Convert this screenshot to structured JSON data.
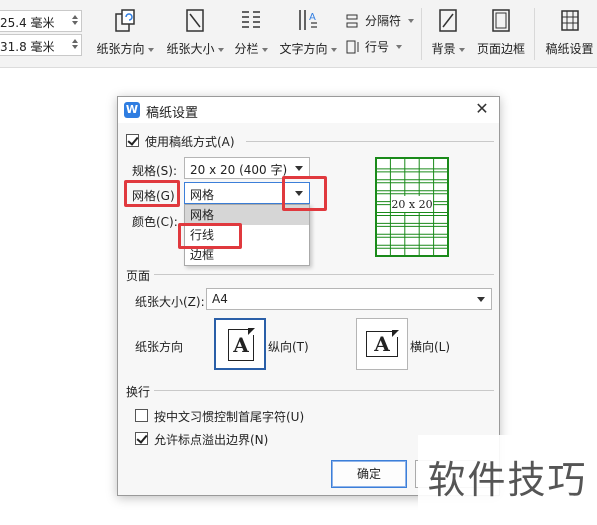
{
  "ribbon": {
    "margin_top_value": "25.4 毫米",
    "margin_bottom_value": "31.8 毫米",
    "paper_orientation": "纸张方向",
    "paper_size": "纸张大小",
    "columns": "分栏",
    "text_direction": "文字方向",
    "separator": "分隔符",
    "line_number": "行号",
    "background": "背景",
    "page_border": "页面边框",
    "manuscript_settings": "稿纸设置"
  },
  "dialog": {
    "logo": "W",
    "title": "稿纸设置",
    "use_manuscript_label": "使用稿纸方式(A)",
    "use_manuscript_checked": true,
    "spec_label": "规格(S):",
    "spec_value": "20 x 20 (400 字)",
    "grid_label": "网格(G)",
    "grid_value": "网格",
    "color_label": "颜色(C):",
    "grid_options": [
      "网格",
      "行线",
      "边框"
    ],
    "preview_text": "20 x 20",
    "preview_color": "#1a8a1a",
    "page_section": "页面",
    "paper_size_label": "纸张大小(Z):",
    "paper_size_value": "A4",
    "orientation_label": "纸张方向",
    "portrait_label": "纵向(T)",
    "landscape_label": "横向(L)",
    "orientation_glyph": "A",
    "wrap_section": "换行",
    "cjk_control_label": "按中文习惯控制首尾字符(U)",
    "cjk_control_checked": false,
    "punct_overflow_label": "允许标点溢出边界(N)",
    "punct_overflow_checked": true,
    "ok_label": "确定",
    "highlight_color": "#e0393e"
  },
  "watermark": "软件技巧"
}
